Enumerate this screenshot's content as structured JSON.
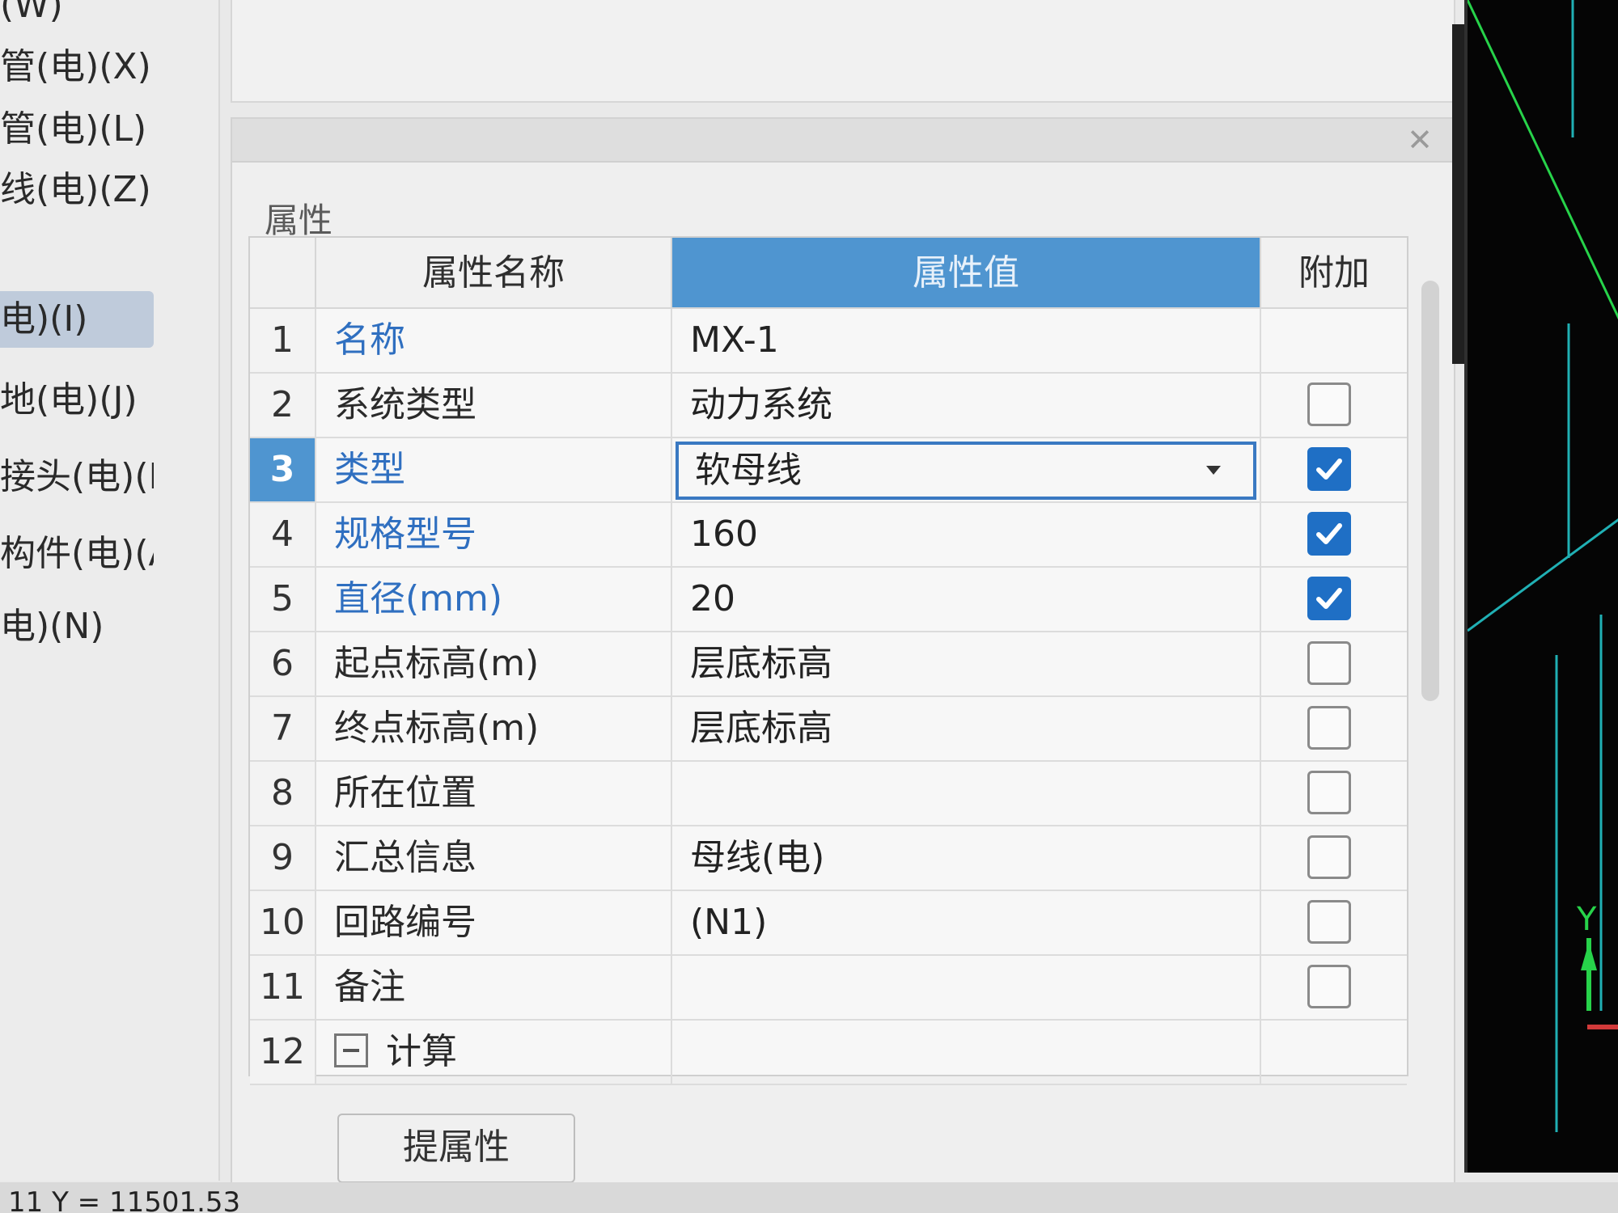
{
  "nav": {
    "items": [
      {
        "label": "(W)"
      },
      {
        "label": "管(电)(X)"
      },
      {
        "label": "管(电)(L)"
      },
      {
        "label": "线(电)(Z)"
      },
      {
        "label": "电)(I)",
        "selected": true
      },
      {
        "label": "地(电)(J)"
      },
      {
        "label": "接头(电)(R)"
      },
      {
        "label": "构件(电)(A)"
      },
      {
        "label": "电)(N)"
      }
    ]
  },
  "panel": {
    "section_title": "属性",
    "headers": {
      "index": "",
      "name": "属性名称",
      "value": "属性值",
      "extra": "附加"
    },
    "rows": [
      {
        "num": "1",
        "name": "名称",
        "value": "MX-1",
        "checkbox": "none",
        "blue": true
      },
      {
        "num": "2",
        "name": "系统类型",
        "value": "动力系统",
        "checkbox": "unchecked",
        "blue": false
      },
      {
        "num": "3",
        "name": "类型",
        "value": "软母线",
        "checkbox": "checked",
        "blue": true,
        "selected": true,
        "editor": "dropdown"
      },
      {
        "num": "4",
        "name": "规格型号",
        "value": "160",
        "checkbox": "checked",
        "blue": true
      },
      {
        "num": "5",
        "name": "直径(mm)",
        "value": "20",
        "checkbox": "checked",
        "blue": true
      },
      {
        "num": "6",
        "name": "起点标高(m)",
        "value": "层底标高",
        "checkbox": "unchecked",
        "blue": false
      },
      {
        "num": "7",
        "name": "终点标高(m)",
        "value": "层底标高",
        "checkbox": "unchecked",
        "blue": false
      },
      {
        "num": "8",
        "name": "所在位置",
        "value": "",
        "checkbox": "unchecked",
        "blue": false
      },
      {
        "num": "9",
        "name": "汇总信息",
        "value": "母线(电)",
        "checkbox": "unchecked",
        "blue": false
      },
      {
        "num": "10",
        "name": "回路编号",
        "value": "(N1)",
        "checkbox": "unchecked",
        "blue": false
      },
      {
        "num": "11",
        "name": "备注",
        "value": "",
        "checkbox": "unchecked",
        "blue": false
      },
      {
        "num": "12",
        "name": "计算",
        "value": "",
        "checkbox": "none",
        "blue": false,
        "expander": "collapse"
      }
    ],
    "extract_button": "提属性"
  },
  "status_bar": {
    "text": "11 Y = 11501.53"
  },
  "colors": {
    "accent": "#4f95d0",
    "link_blue": "#2f6fc0",
    "checkbox_blue": "#1f6fc5"
  }
}
